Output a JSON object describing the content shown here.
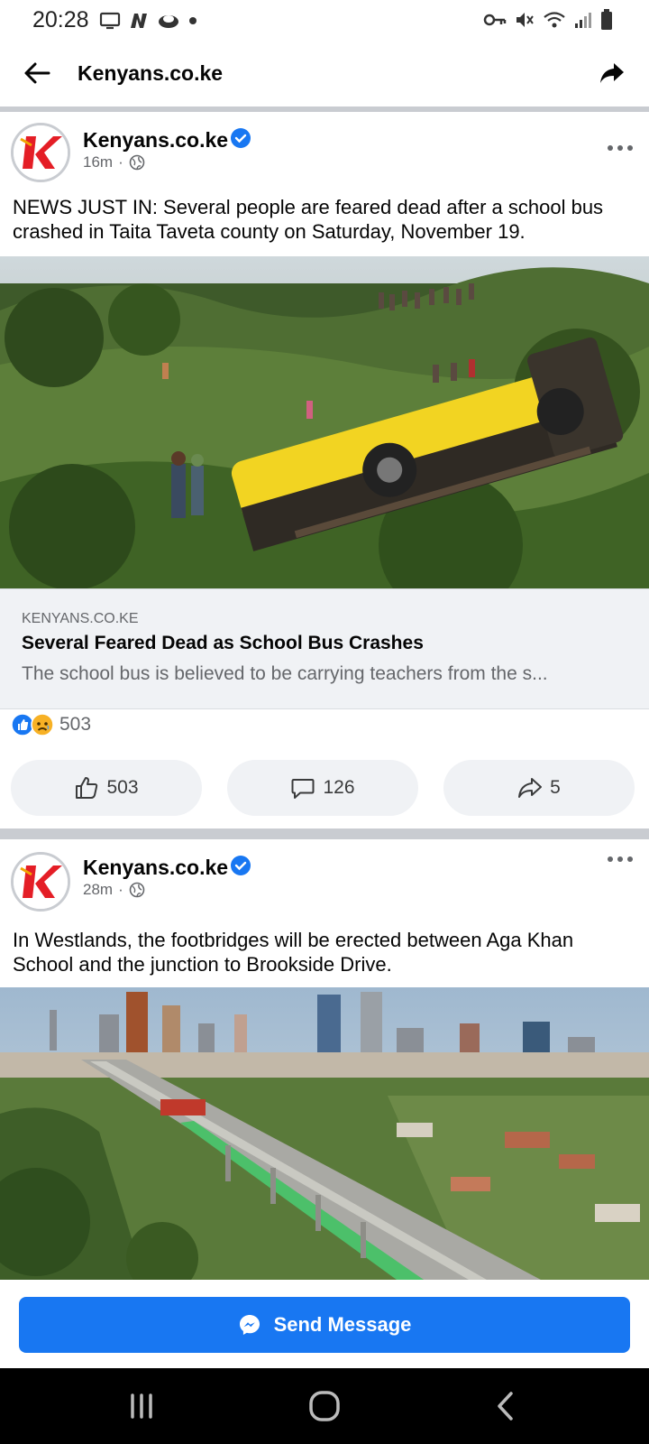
{
  "status_bar": {
    "time": "20:28",
    "left_icons": [
      "screen-mirror-icon",
      "n-badge-icon",
      "cap-icon",
      "dot-icon"
    ],
    "right_icons": [
      "key-icon",
      "mute-icon",
      "wifi-icon",
      "signal-icon",
      "battery-icon"
    ]
  },
  "app_bar": {
    "title": "Kenyans.co.ke"
  },
  "posts": [
    {
      "page_name": "Kenyans.co.ke",
      "verified": true,
      "time": "16m",
      "separator": "·",
      "audience_icon": "globe-icon",
      "text": "NEWS JUST IN: Several people are feared dead after a school bus crashed in Taita Taveta county on Saturday, November 19.",
      "link_card": {
        "domain": "KENYANS.CO.KE",
        "title": "Several Feared Dead as School Bus Crashes",
        "description": "The school bus is believed to be carrying teachers from the s..."
      },
      "reaction_icons": [
        "like-reaction-icon",
        "sad-reaction-icon"
      ],
      "reaction_count": "503",
      "actions": {
        "like": "503",
        "comment": "126",
        "share": "5"
      }
    },
    {
      "page_name": "Kenyans.co.ke",
      "verified": true,
      "time": "28m",
      "separator": "·",
      "audience_icon": "globe-icon",
      "text": "In Westlands, the footbridges will be erected between Aga Khan School and the junction to Brookside Drive."
    }
  ],
  "send_message": {
    "label": "Send Message"
  },
  "colors": {
    "brand_blue": "#1877f2",
    "logo_red": "#e41e26",
    "bus_yellow": "#f2d422"
  }
}
